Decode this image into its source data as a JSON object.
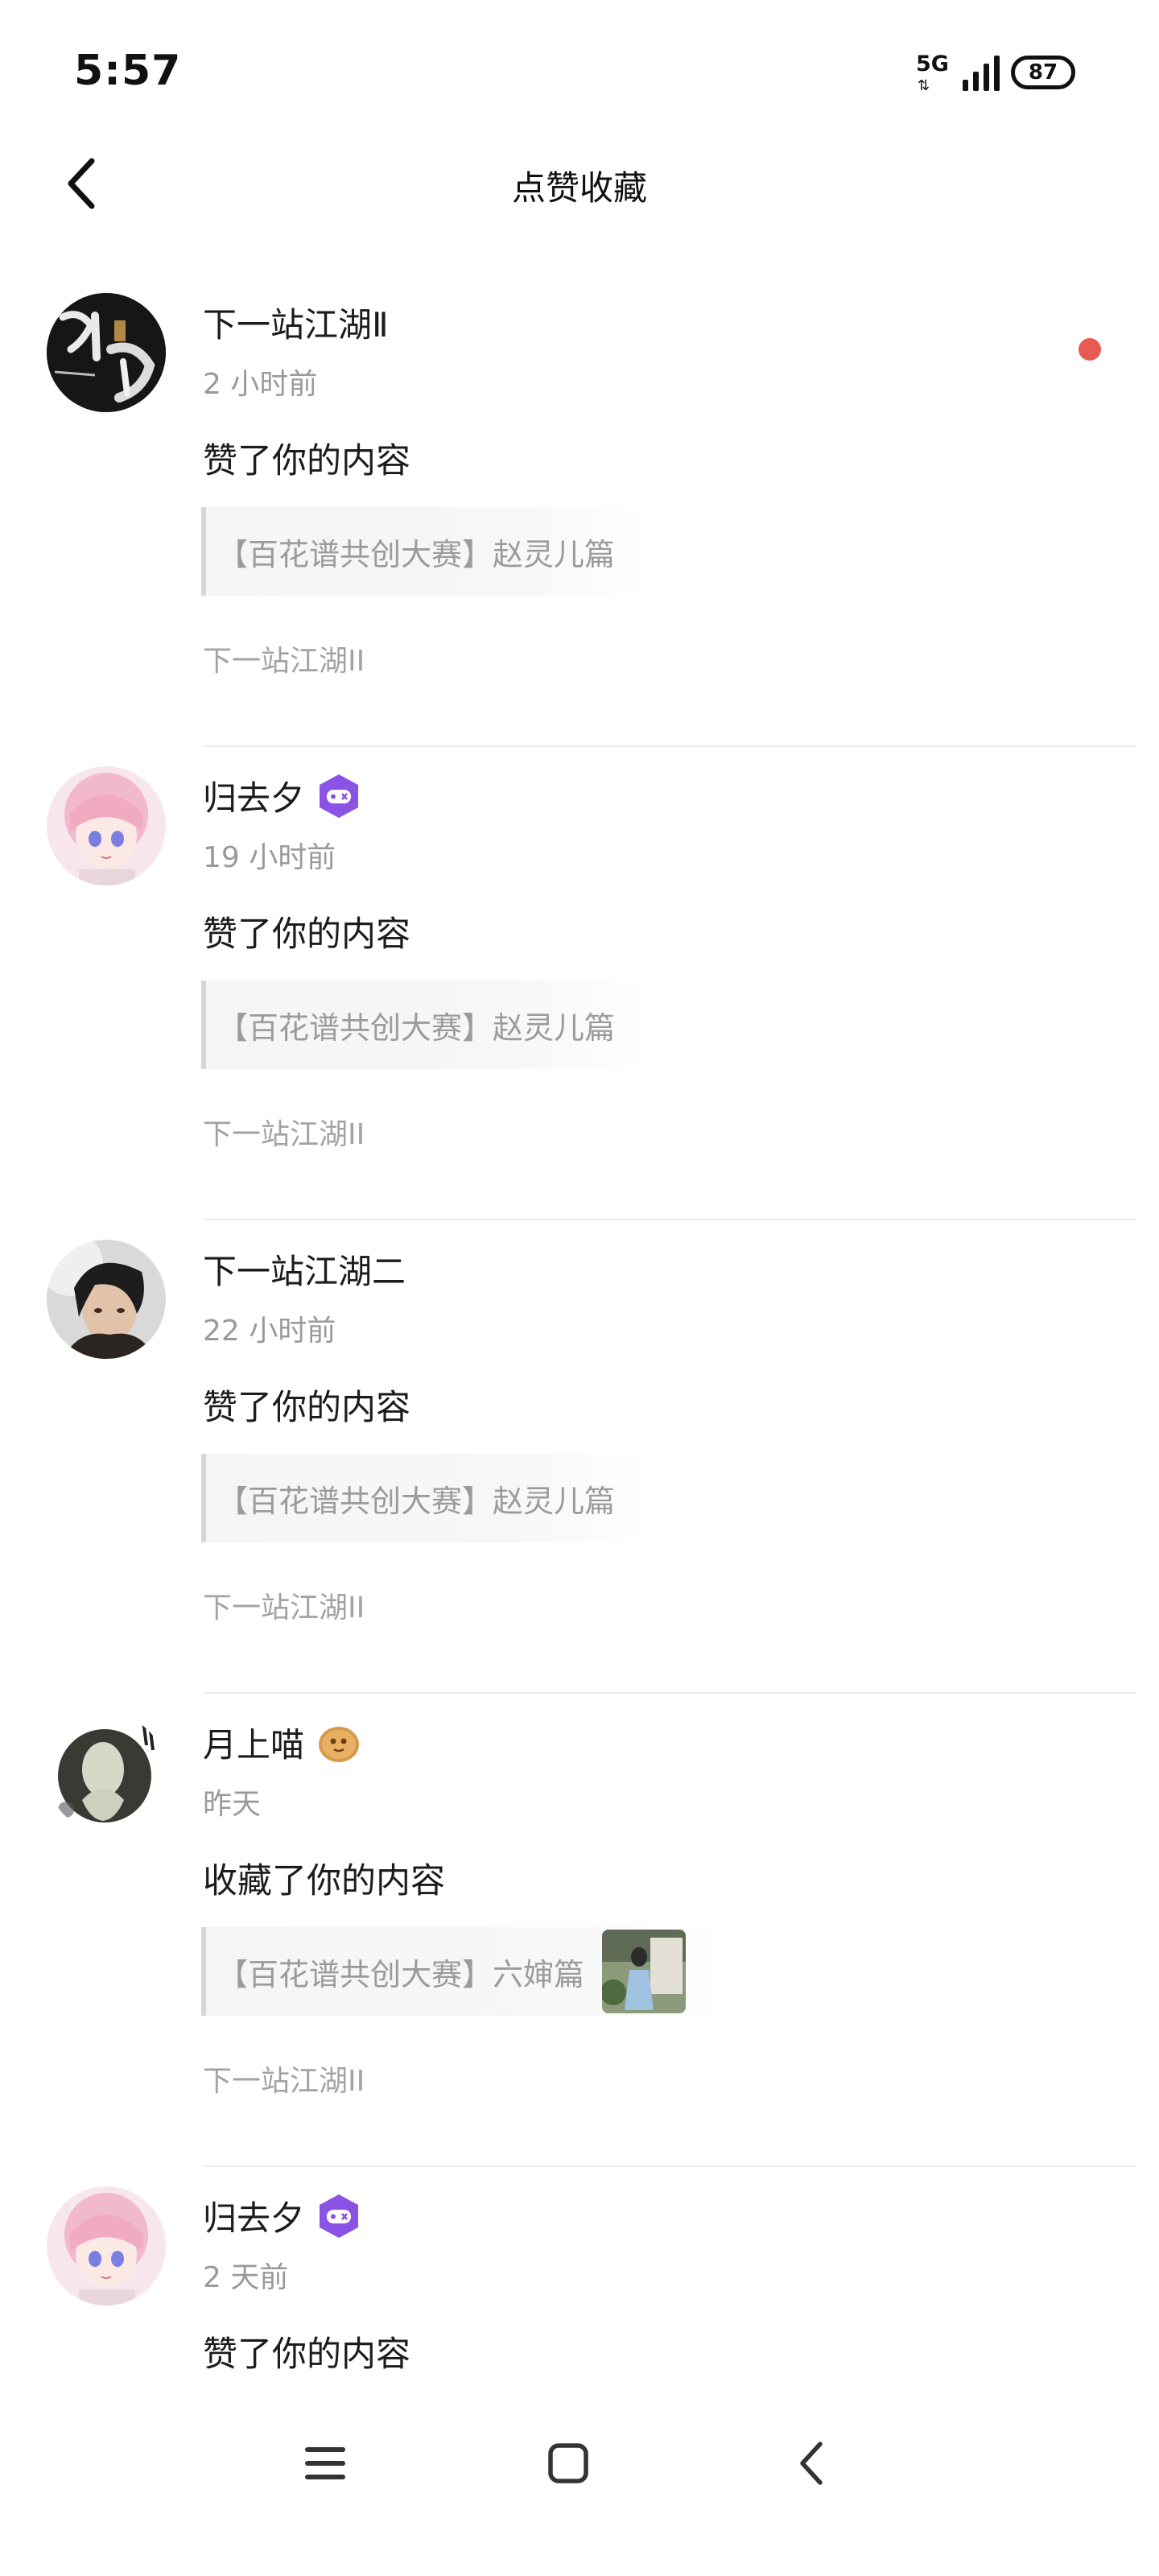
{
  "status_bar": {
    "time": "5:57",
    "network": "5G",
    "network_sub": "⇅",
    "battery": "87"
  },
  "header": {
    "title": "点赞收藏"
  },
  "items": [
    {
      "user": "下一站江湖Ⅱ",
      "time": "2 小时前",
      "action": "赞了你的内容",
      "quote": "【百花谱共创大赛】赵灵儿篇",
      "source": "下一站江湖II",
      "unread": true,
      "avatar_text": "江湖"
    },
    {
      "user": "归去夕",
      "time": "19 小时前",
      "action": "赞了你的内容",
      "quote": "【百花谱共创大赛】赵灵儿篇",
      "source": "下一站江湖II",
      "badge": "game-controller-badge"
    },
    {
      "user": "下一站江湖二",
      "time": "22 小时前",
      "action": "赞了你的内容",
      "quote": "【百花谱共创大赛】赵灵儿篇",
      "source": "下一站江湖II"
    },
    {
      "user": "月上喵",
      "time": "昨天",
      "action": "收藏了你的内容",
      "quote": "【百花谱共创大赛】六婶篇",
      "source": "下一站江湖II",
      "badge": "cookie-badge",
      "has_thumbnail": true
    },
    {
      "user": "归去夕",
      "time": "2 天前",
      "action": "赞了你的内容",
      "badge": "game-controller-badge"
    }
  ],
  "colors": {
    "unread_dot": "#e85b52",
    "badge_purple": "#8b52e6",
    "divider": "#ececec"
  }
}
